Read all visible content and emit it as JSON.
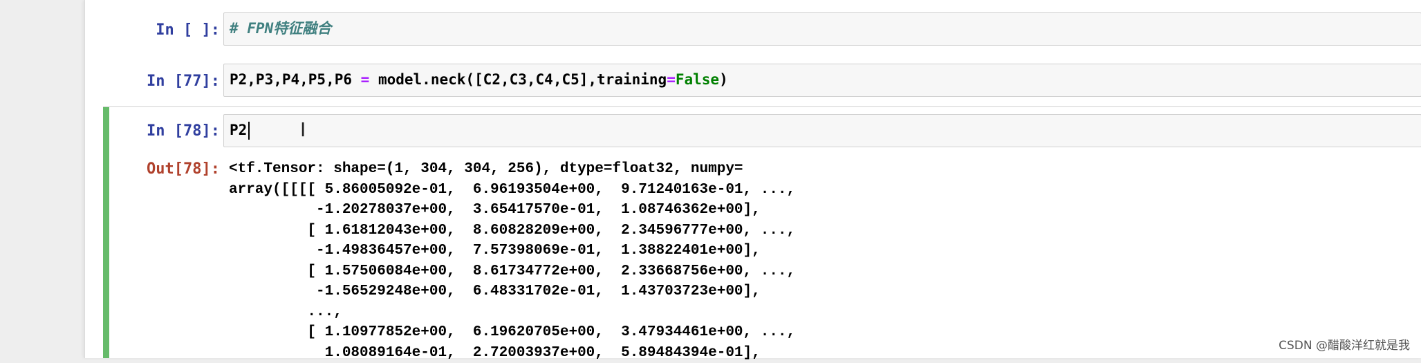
{
  "cells": [
    {
      "prompt": "In [ ]:",
      "code_comment": "# FPN特征融合"
    },
    {
      "prompt": "In [77]:",
      "code": {
        "part1": "P2,P3,P4,P5,P6 ",
        "eq": "=",
        "part2": " model.neck([C2,C3,C4,C5],training",
        "eq2": "=",
        "kw": "False",
        "part3": ")"
      }
    },
    {
      "prompt": "In [78]:",
      "code_text": "P2",
      "out_prompt": "Out[78]:",
      "output_lines": [
        "<tf.Tensor: shape=(1, 304, 304, 256), dtype=float32, numpy=",
        "array([[[[ 5.86005092e-01,  6.96193504e+00,  9.71240163e-01, ...,",
        "          -1.20278037e+00,  3.65417570e-01,  1.08746362e+00],",
        "         [ 1.61812043e+00,  8.60828209e+00,  2.34596777e+00, ...,",
        "          -1.49836457e+00,  7.57398069e-01,  1.38822401e+00],",
        "         [ 1.57506084e+00,  8.61734772e+00,  2.33668756e+00, ...,",
        "          -1.56529248e+00,  6.48331702e-01,  1.43703723e+00],",
        "         ...,",
        "         [ 1.10977852e+00,  6.19620705e+00,  3.47934461e+00, ...,",
        "           1.08089164e-01,  2.72003937e+00,  5.89484394e-01],"
      ]
    }
  ],
  "watermark": "CSDN @醋酸洋红就是我",
  "colors": {
    "in_prompt": "#303f9f",
    "out_prompt": "#b0412c",
    "selected_bar": "#66bb6a",
    "comment": "#408080",
    "keyword": "#008000",
    "operator": "#aa22ff"
  }
}
